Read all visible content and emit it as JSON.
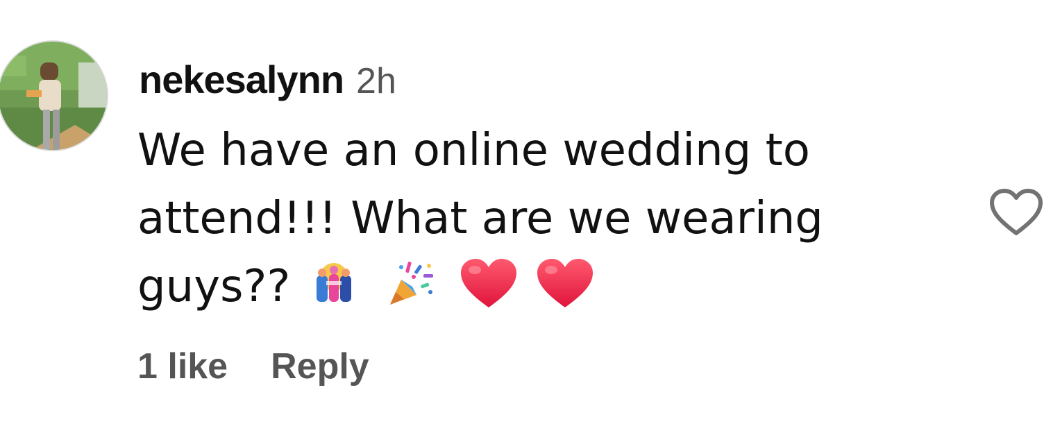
{
  "comment": {
    "username": "nekesalynn",
    "timestamp": "2h",
    "text_lines": [
      "We have an online wedding to",
      "attend!!! What are we wearing",
      "guys??"
    ],
    "emojis": [
      "dancers-emoji",
      "party-popper-emoji",
      "red-heart-emoji",
      "red-heart-emoji"
    ],
    "like_count_label": "1 like",
    "reply_label": "Reply"
  },
  "colors": {
    "text_primary": "#111111",
    "text_secondary": "#555555",
    "heart_red": "#ef2a4f",
    "like_outline": "#737373"
  }
}
